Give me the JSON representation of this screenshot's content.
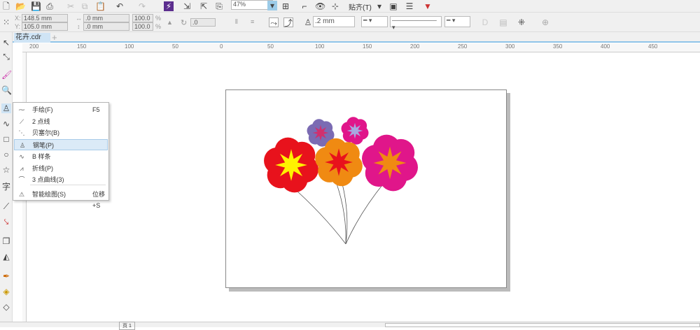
{
  "toolbar": {
    "zoom": "47%",
    "snap_label": "贴齐(T)"
  },
  "properties": {
    "x": "148.5 mm",
    "y": "105.0 mm",
    "width": ".0 mm",
    "height": ".0 mm",
    "scale_x": "100.0",
    "scale_y": "100.0",
    "percent": "%",
    "rotation": ".0",
    "outline_width": ".2 mm"
  },
  "document_tab": {
    "label": "花卉.cdr"
  },
  "ruler": {
    "labels": [
      "200",
      "150",
      "100",
      "50",
      "0",
      "50",
      "100",
      "150",
      "200",
      "250",
      "300",
      "350",
      "400",
      "450"
    ]
  },
  "menu": {
    "items": [
      {
        "label": "手绘(F)",
        "shortcut": "F5",
        "icon": "freehand-icon"
      },
      {
        "label": "2 点线",
        "shortcut": "",
        "icon": "two-point-line-icon"
      },
      {
        "label": "贝塞尔(B)",
        "shortcut": "",
        "icon": "bezier-icon"
      },
      {
        "label": "钢笔(P)",
        "shortcut": "",
        "icon": "pen-icon",
        "selected": true
      },
      {
        "label": "B 样条",
        "shortcut": "",
        "icon": "b-spline-icon"
      },
      {
        "label": "折线(P)",
        "shortcut": "",
        "icon": "polyline-icon"
      },
      {
        "label": "3 点曲线(3)",
        "shortcut": "",
        "icon": "three-point-curve-icon"
      },
      {
        "label": "智能绘图(S)",
        "shortcut": "位移+S",
        "icon": "smart-drawing-icon"
      }
    ]
  },
  "status": {
    "page_tab": "页 1"
  },
  "colors": {
    "accent": "#8fc4e8",
    "red": "#e8121c",
    "yellow": "#fff200",
    "orange": "#f08a12",
    "magenta": "#e0168a",
    "purple": "#7b6bb3"
  }
}
